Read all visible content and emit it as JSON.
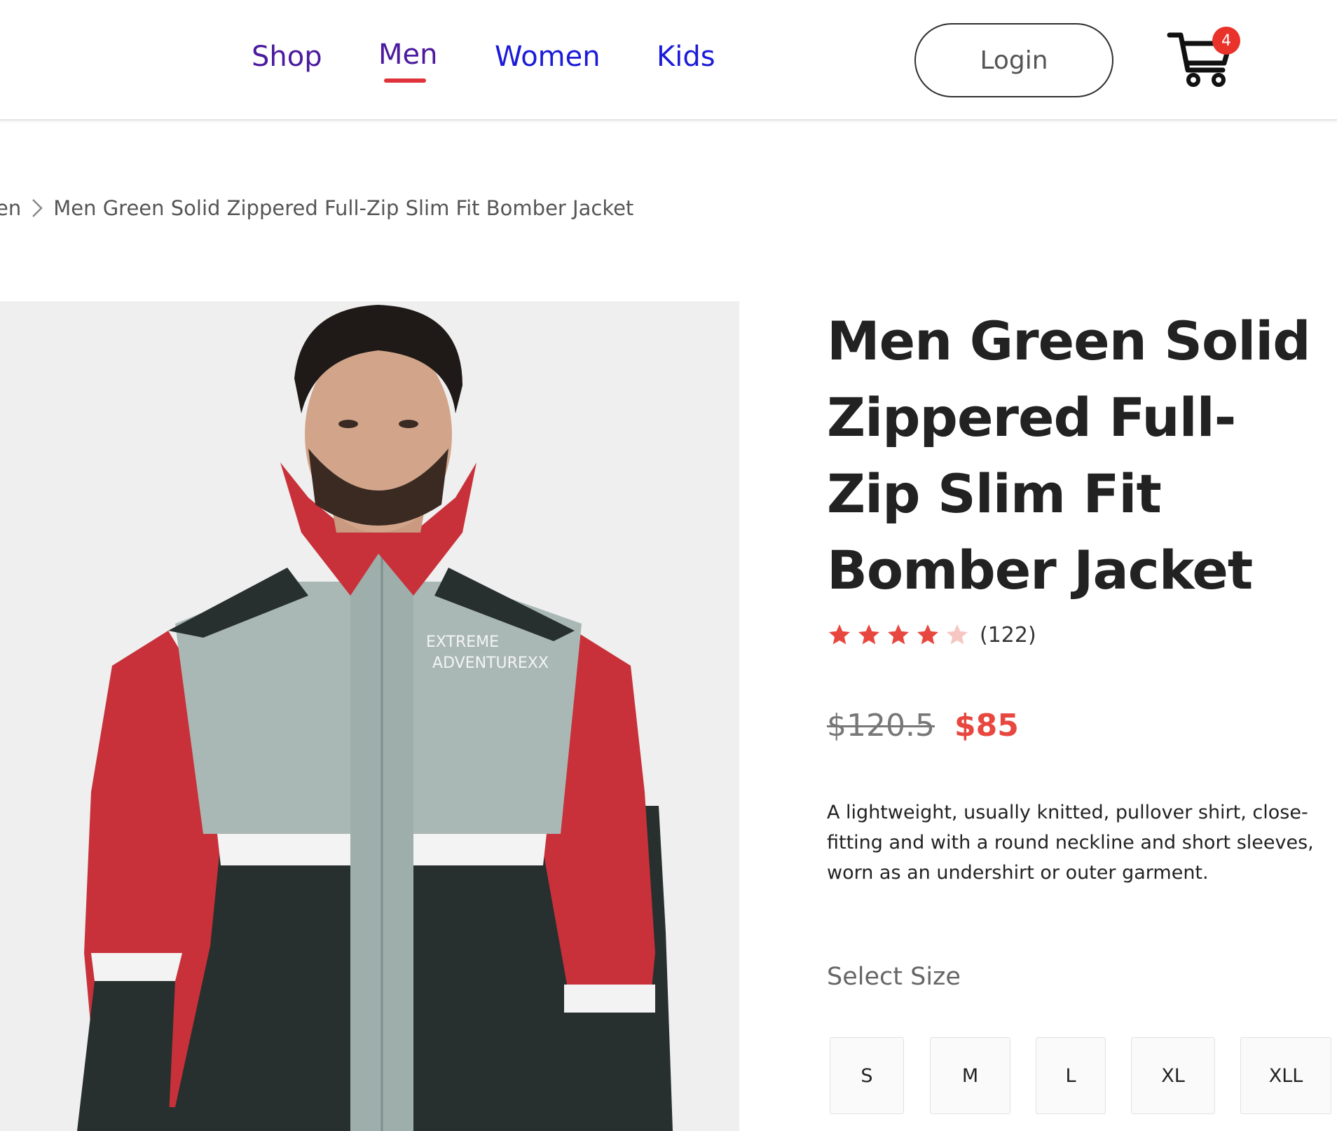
{
  "header": {
    "nav": {
      "shop": "Shop",
      "men": "Men",
      "women": "Women",
      "kids": "Kids"
    },
    "active_nav": "Men",
    "login_label": "Login",
    "cart_count": "4",
    "accent_color": "#e0323a"
  },
  "breadcrumb": {
    "parent": "en",
    "current": "Men Green Solid Zippered Full-Zip Slim Fit Bomber Jacket"
  },
  "product": {
    "image_alt_text_on_jacket": "EXTREME ADVENTUREXX",
    "title": "Men Green Solid Zippered Full-Zip Slim Fit Bomber Jacket",
    "rating": 4,
    "rating_max": 5,
    "review_count": "(122)",
    "price_original": "$120.5",
    "price_sale": "$85",
    "price_sale_color": "#e8473f",
    "description": "A lightweight, usually knitted, pullover shirt, close-fitting and with a round neckline and short sleeves, worn as an undershirt or outer garment.",
    "size_label": "Select Size",
    "sizes": [
      "S",
      "M",
      "L",
      "XL",
      "XLL"
    ]
  }
}
